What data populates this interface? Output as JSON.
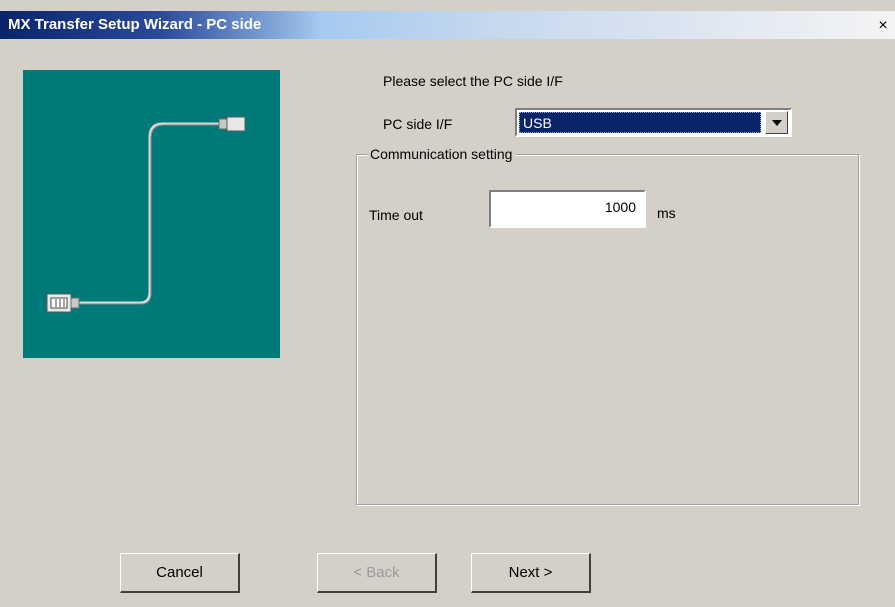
{
  "window": {
    "title": "MX Transfer Setup Wizard - PC side",
    "close_glyph": "×"
  },
  "illustration": {
    "icon": "cable-icon",
    "background_color": "#007a78"
  },
  "form": {
    "prompt": "Please select the PC side I/F",
    "pc_if_label": "PC side I/F",
    "pc_if_value": "USB"
  },
  "comm_setting": {
    "legend": "Communication setting",
    "timeout_label": "Time out",
    "timeout_value": "1000",
    "timeout_unit": "ms"
  },
  "buttons": {
    "cancel": "Cancel",
    "back": "< Back",
    "back_enabled": false,
    "next": "Next >"
  },
  "colors": {
    "titlebar_start": "#0a246a",
    "dialog_face": "#d4d0c8",
    "selection": "#0a246a"
  }
}
